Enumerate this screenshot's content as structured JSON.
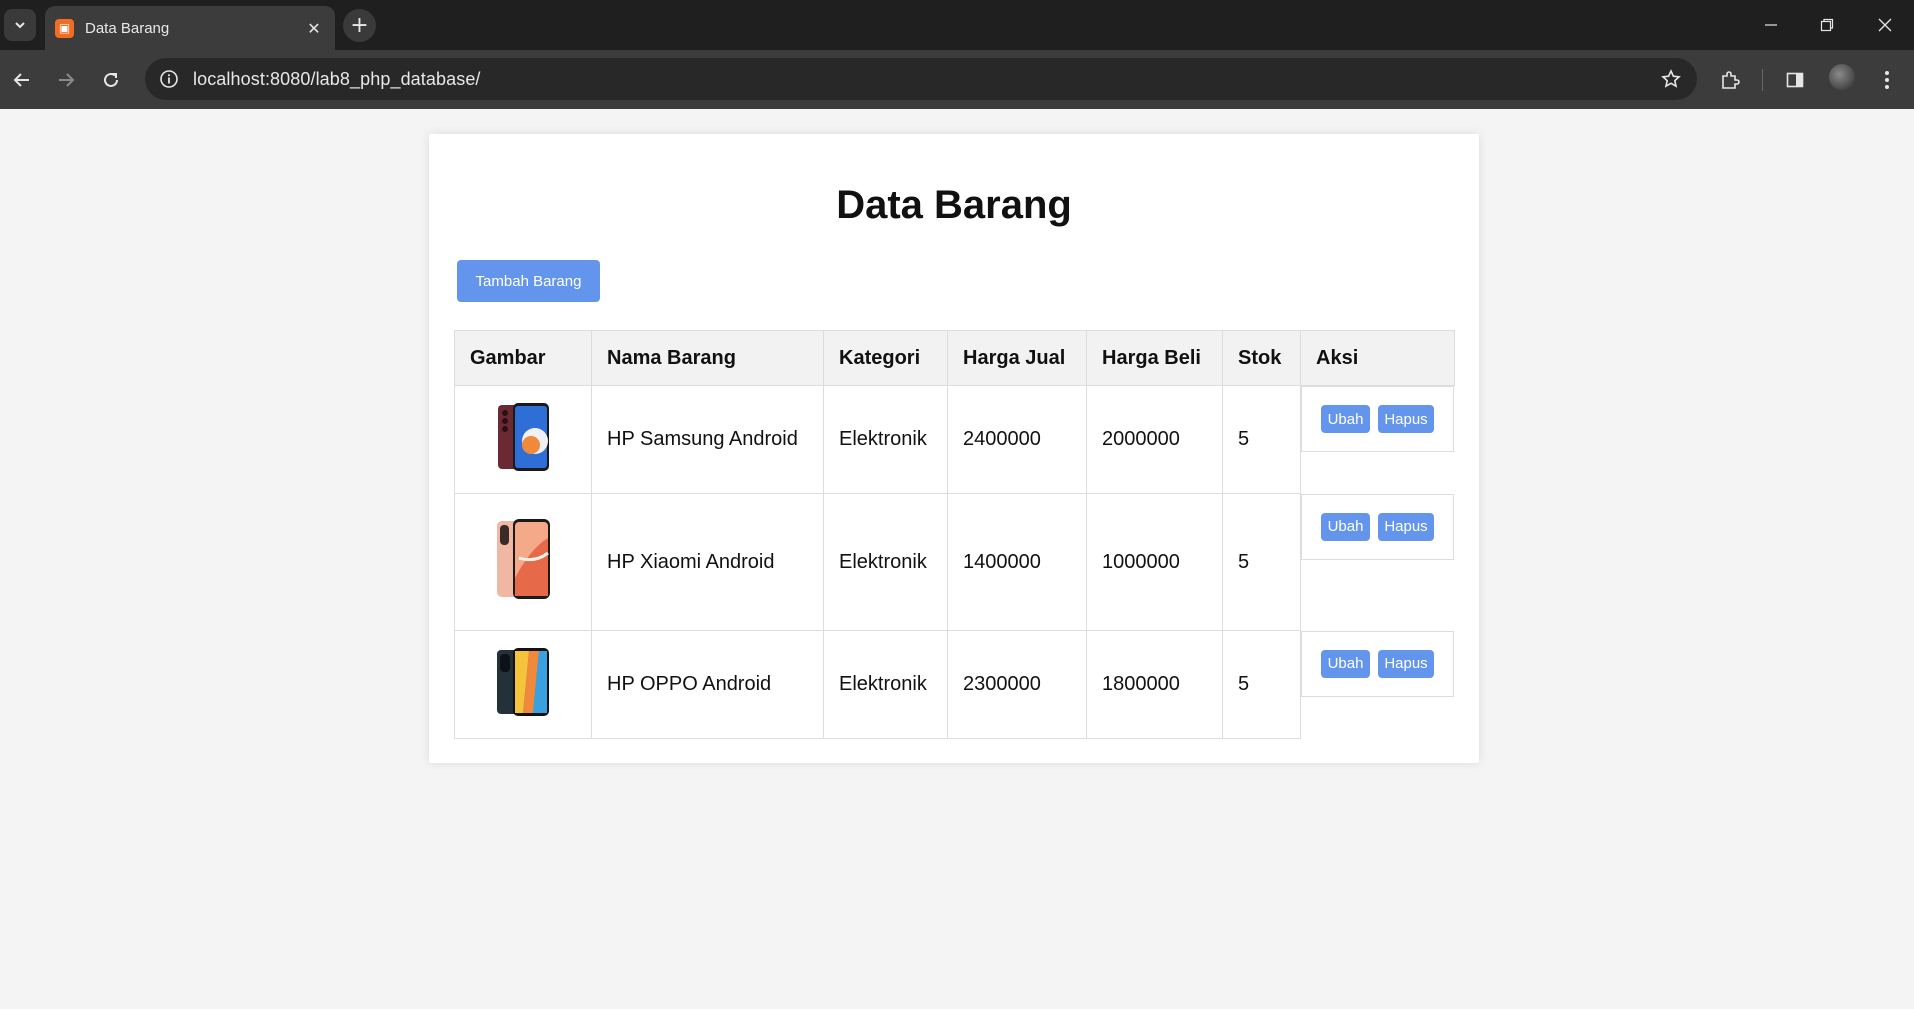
{
  "browser": {
    "tab_title": "Data Barang",
    "tab_favicon": "xampp-icon",
    "url": "localhost:8080/lab8_php_database/"
  },
  "page": {
    "title": "Data Barang",
    "add_button": "Tambah Barang"
  },
  "table": {
    "headers": [
      "Gambar",
      "Nama Barang",
      "Kategori",
      "Harga Jual",
      "Harga Beli",
      "Stok",
      "Aksi"
    ],
    "rows": [
      {
        "nama": "HP Samsung Android",
        "kategori": "Elektronik",
        "harga_jual": "2400000",
        "harga_beli": "2000000",
        "stok": "5",
        "ubah": "Ubah",
        "hapus": "Hapus",
        "image": "samsung-phone-image"
      },
      {
        "nama": "HP Xiaomi Android",
        "kategori": "Elektronik",
        "harga_jual": "1400000",
        "harga_beli": "1000000",
        "stok": "5",
        "ubah": "Ubah",
        "hapus": "Hapus",
        "image": "xiaomi-phone-image"
      },
      {
        "nama": "HP OPPO Android",
        "kategori": "Elektronik",
        "harga_jual": "2300000",
        "harga_beli": "1800000",
        "stok": "5",
        "ubah": "Ubah",
        "hapus": "Hapus",
        "image": "oppo-phone-image"
      }
    ]
  },
  "colors": {
    "accent": "#6495ed",
    "header_bg": "#f2f2f2",
    "page_bg": "#f4f4f4"
  }
}
